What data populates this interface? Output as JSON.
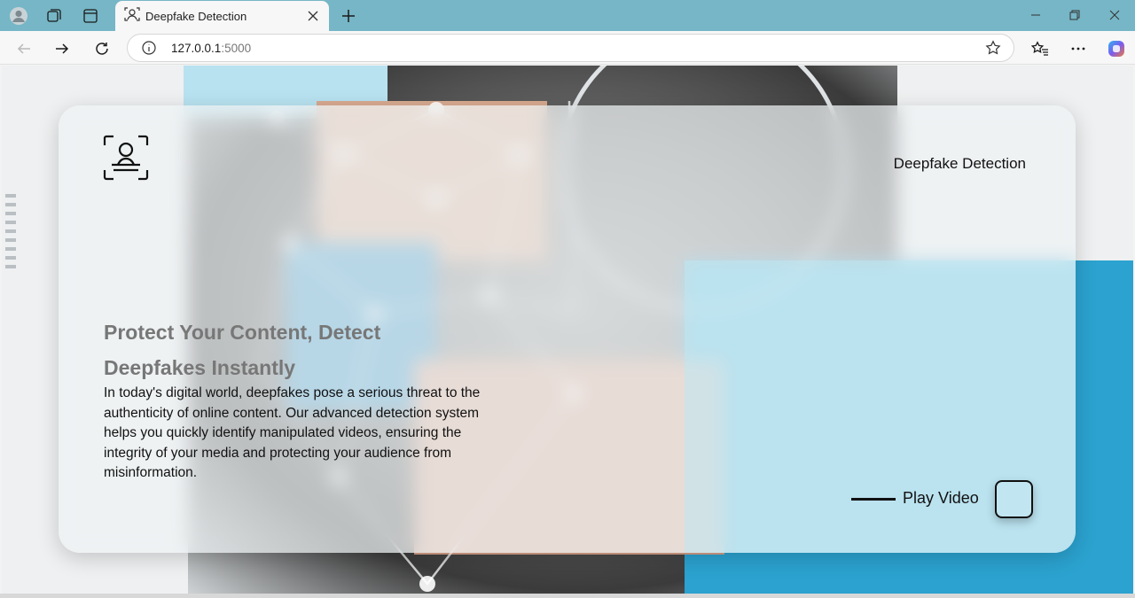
{
  "browser": {
    "tab_title": "Deepfake Detection",
    "url_host": "127.0.0.1",
    "url_port": ":5000",
    "accent": "#76b6c6"
  },
  "page": {
    "brand": "Deepfake Detection",
    "headline": "Protect Your Content, Detect Deepfakes Instantly",
    "description": "In today's digital world, deepfakes pose a serious threat to the authenticity of online content. Our advanced detection system helps you quickly identify manipulated videos, ensuring the integrity of your media and protecting your audience from misinformation.",
    "play_label": "Play Video",
    "logo_icon": "face-scan-icon"
  }
}
